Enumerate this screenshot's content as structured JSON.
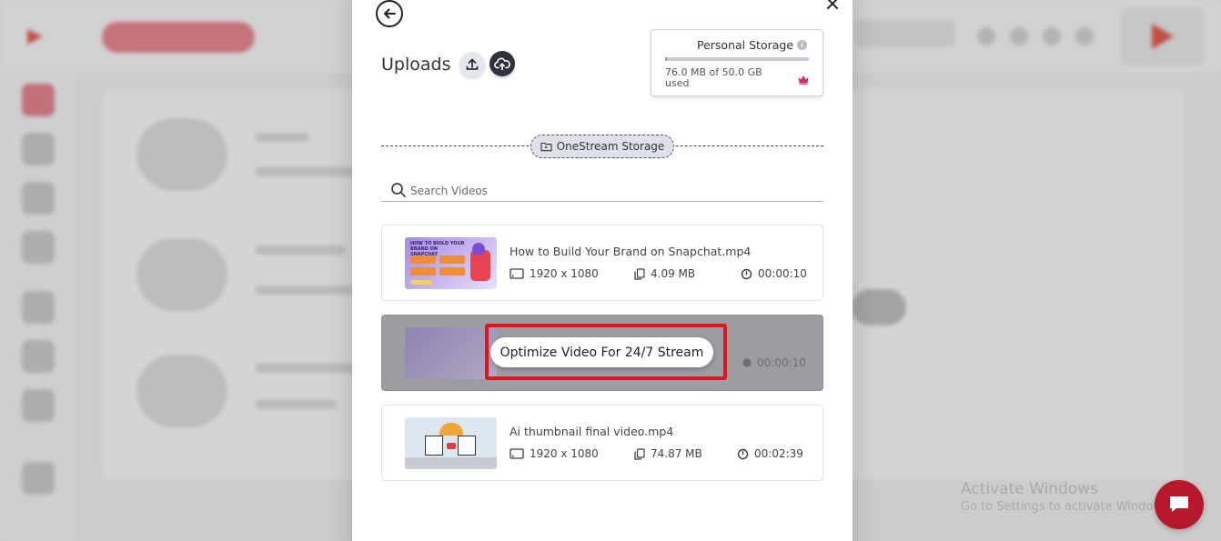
{
  "modal": {
    "title": "Uploads",
    "storage": {
      "title": "Personal Storage",
      "used_text": "76.0 MB of 50.0 GB used",
      "used_fraction": 0.0015
    },
    "section_tag": "OneStream Storage",
    "search": {
      "placeholder": "Search Videos",
      "value": ""
    },
    "videos": [
      {
        "name": "How to Build Your Brand on Snapchat.mp4",
        "resolution": "1920 x 1080",
        "size": "4.09 MB",
        "duration": "00:00:10",
        "thumb_title": "HOW TO BUILD YOUR BRAND ON SNAPCHAT"
      },
      {
        "name": "",
        "ghost_duration": "00:00:10",
        "highlighted": true,
        "action_label": "Optimize Video For 24/7 Stream"
      },
      {
        "name": "Ai thumbnail final video.mp4",
        "resolution": "1920 x 1080",
        "size": "74.87 MB",
        "duration": "00:02:39"
      }
    ]
  },
  "watermark": {
    "line1": "Activate Windows",
    "line2": "Go to Settings to activate Windows."
  },
  "colors": {
    "highlight_frame": "#e1141c",
    "chat": "#b8172c",
    "brand": "#e2574c"
  }
}
